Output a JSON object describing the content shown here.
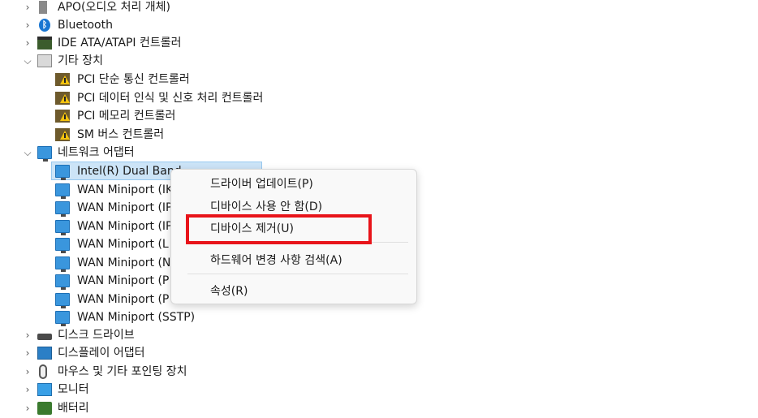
{
  "tree": {
    "apo": "APO(오디오 처리 개체)",
    "bluetooth": "Bluetooth",
    "ide": "IDE ATA/ATAPI 컨트롤러",
    "other": "기타 장치",
    "other_items": [
      "PCI 단순 통신 컨트롤러",
      "PCI 데이터 인식 및 신호 처리 컨트롤러",
      "PCI 메모리 컨트롤러",
      "SM 버스 컨트롤러"
    ],
    "network": "네트워크 어댑터",
    "network_items": [
      "Intel(R) Dual Band",
      "WAN Miniport (IK",
      "WAN Miniport (IP",
      "WAN Miniport (IP",
      "WAN Miniport (L",
      "WAN Miniport (N",
      "WAN Miniport (P",
      "WAN Miniport (P",
      "WAN Miniport (SSTP)"
    ],
    "disk": "디스크 드라이브",
    "display": "디스플레이 어댑터",
    "mouse": "마우스 및 기타 포인팅 장치",
    "monitor": "모니터",
    "battery": "배터리"
  },
  "context_menu": {
    "update_driver": "드라이버 업데이트(P)",
    "disable_device": "디바이스 사용 안 함(D)",
    "uninstall_device": "디바이스 제거(U)",
    "scan_hardware": "하드웨어 변경 사항 검색(A)",
    "properties": "속성(R)"
  },
  "colors": {
    "highlight_border": "#e8141a",
    "selection": "#cce4f7"
  }
}
